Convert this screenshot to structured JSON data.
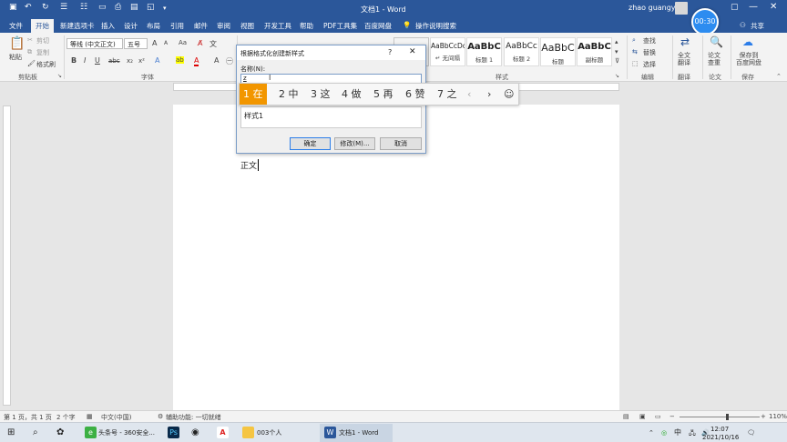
{
  "title_bar": {
    "doc_title": "文档1 - Word",
    "user": "zhao guangyu",
    "share_label": "共享"
  },
  "timer": "00:30",
  "tabs": [
    "文件",
    "开始",
    "新建选项卡",
    "插入",
    "设计",
    "布局",
    "引用",
    "邮件",
    "审阅",
    "视图",
    "开发工具",
    "帮助",
    "PDF工具集",
    "百度网盘"
  ],
  "tell_me": "操作说明搜索",
  "ribbon": {
    "clipboard": {
      "paste": "粘贴",
      "cut": "剪切",
      "copy": "复制",
      "format_painter": "格式刷",
      "group": "剪贴板"
    },
    "font": {
      "name": "等线 (中文正文)",
      "size": "五号",
      "group": "字体",
      "bold": "B",
      "italic": "I",
      "underline": "U",
      "strike": "abc",
      "sub": "x₂",
      "sup": "x²",
      "grow": "A",
      "shrink": "A",
      "case": "Aa",
      "font_color": "A",
      "highlight": "A"
    },
    "styles": {
      "items": [
        {
          "sample": "AaBbCcDc",
          "name": "↵ 无间隔"
        },
        {
          "sample": "AaBbC",
          "name": "标题 1"
        },
        {
          "sample": "AaBbCc",
          "name": "标题 2"
        },
        {
          "sample": "AaBbC",
          "name": "标题"
        },
        {
          "sample": "AaBbC",
          "name": "副标题"
        }
      ],
      "group": "样式"
    },
    "editing": {
      "find": "查找",
      "replace": "替换",
      "select": "选择",
      "group": "编辑"
    },
    "translate": {
      "label": "全文\n翻译",
      "group": "翻译"
    },
    "paper": {
      "label": "论文\n查重",
      "group": "论文"
    },
    "save": {
      "label": "保存到\n百度网盘",
      "group": "保存"
    }
  },
  "dialog": {
    "title": "根据格式化创建新样式",
    "help": "?",
    "name_label": "名称(N):",
    "input_value": "z",
    "preview_text": "样式1",
    "ok": "确定",
    "modify": "修改(M)...",
    "cancel": "取消"
  },
  "ime": {
    "candidates": [
      "1 在",
      "2 中",
      "3 这",
      "4 做",
      "5 再",
      "6 赞",
      "7 之"
    ]
  },
  "document": {
    "text": "正文"
  },
  "status": {
    "page": "第 1 页，共 1 页",
    "words": "2 个字",
    "language": "中文(中国)",
    "accessibility": "辅助功能: 一切就绪",
    "zoom": "110%"
  },
  "taskbar": {
    "items": [
      "头条号 - 360安全...",
      "003个人",
      "文档1 - Word"
    ],
    "ime": "中",
    "time": "12:07",
    "date": "2021/10/16"
  }
}
